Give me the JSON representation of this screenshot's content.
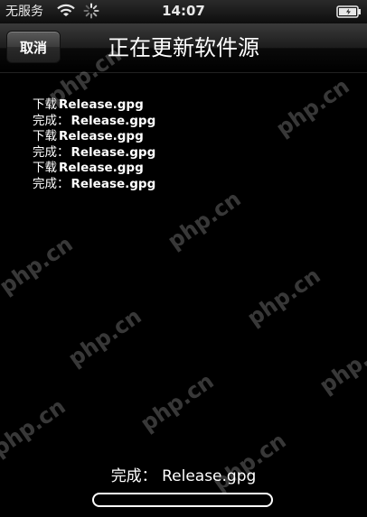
{
  "status_bar": {
    "carrier": "无服务",
    "time": "14:07"
  },
  "nav": {
    "cancel_label": "取消",
    "title": "正在更新软件源"
  },
  "log": [
    {
      "action": "下载",
      "file": "Release.gpg"
    },
    {
      "action": "完成：",
      "file": "Release.gpg"
    },
    {
      "action": "下载",
      "file": "Release.gpg"
    },
    {
      "action": "完成：",
      "file": "Release.gpg"
    },
    {
      "action": "下载",
      "file": "Release.gpg"
    },
    {
      "action": "完成：",
      "file": "Release.gpg"
    }
  ],
  "bottom": {
    "status_text": "完成：  Release.gpg",
    "progress": 0.0
  },
  "watermark": "php.cn",
  "colors": {
    "background": "#000000",
    "text": "#ffffff",
    "nav_bar": "#1c1c1c"
  },
  "icons": {
    "wifi": "wifi-icon",
    "activity": "spinner-icon",
    "battery": "battery-icon"
  }
}
